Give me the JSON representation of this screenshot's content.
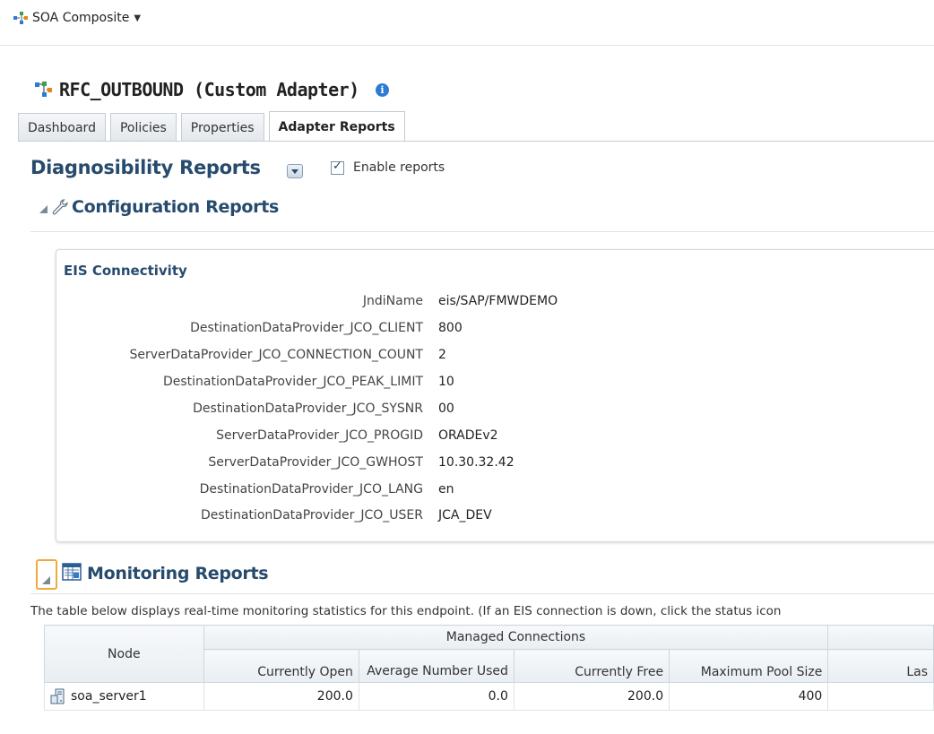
{
  "header": {
    "menu_label": "SOA Composite"
  },
  "page": {
    "title": "RFC_OUTBOUND (Custom Adapter)"
  },
  "tabs": [
    {
      "label": "Dashboard",
      "active": false
    },
    {
      "label": "Policies",
      "active": false
    },
    {
      "label": "Properties",
      "active": false
    },
    {
      "label": "Adapter Reports",
      "active": true
    }
  ],
  "diagnosibility": {
    "title": "Diagnosibility Reports",
    "enable_label": "Enable reports",
    "enabled": true
  },
  "configuration": {
    "title": "Configuration Reports",
    "eis": {
      "title": "EIS Connectivity",
      "properties": [
        {
          "label": "JndiName",
          "value": "eis/SAP/FMWDEMO"
        },
        {
          "label": "DestinationDataProvider_JCO_CLIENT",
          "value": "800"
        },
        {
          "label": "ServerDataProvider_JCO_CONNECTION_COUNT",
          "value": "2"
        },
        {
          "label": "DestinationDataProvider_JCO_PEAK_LIMIT",
          "value": "10"
        },
        {
          "label": "DestinationDataProvider_JCO_SYSNR",
          "value": "00"
        },
        {
          "label": "ServerDataProvider_JCO_PROGID",
          "value": "ORADEv2"
        },
        {
          "label": "ServerDataProvider_JCO_GWHOST",
          "value": "10.30.32.42"
        },
        {
          "label": "DestinationDataProvider_JCO_LANG",
          "value": "en"
        },
        {
          "label": "DestinationDataProvider_JCO_USER",
          "value": "JCA_DEV"
        }
      ]
    }
  },
  "monitoring": {
    "title": "Monitoring Reports",
    "description": "The table below displays real-time monitoring statistics for this endpoint. (If an EIS connection is down, click the status icon",
    "table": {
      "node_header": "Node",
      "group_header": "Managed Connections",
      "columns": [
        "Currently Open",
        "Average Number Used",
        "Currently Free",
        "Maximum Pool Size",
        "Las"
      ],
      "rows": [
        {
          "node": "soa_server1",
          "values": [
            "200.0",
            "0.0",
            "200.0",
            "400",
            ""
          ]
        }
      ]
    }
  },
  "colors": {
    "heading": "#274b6d",
    "accent": "#2f7ad3",
    "focus": "#f0a93a"
  }
}
